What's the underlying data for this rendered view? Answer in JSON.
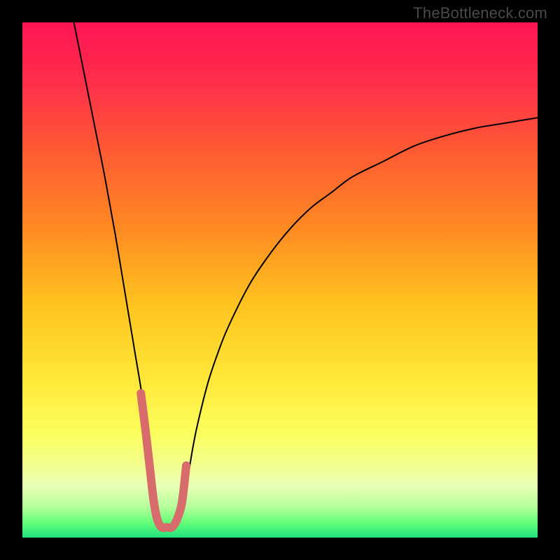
{
  "watermark": "TheBottleneck.com",
  "chart_data": {
    "type": "line",
    "title": "",
    "xlabel": "",
    "ylabel": "",
    "xlim": [
      0,
      100
    ],
    "ylim": [
      0,
      100
    ],
    "background_gradient": {
      "stops": [
        {
          "offset": 0.0,
          "color": "#ff1454"
        },
        {
          "offset": 0.12,
          "color": "#ff2f4a"
        },
        {
          "offset": 0.25,
          "color": "#ff5a33"
        },
        {
          "offset": 0.4,
          "color": "#ff8a22"
        },
        {
          "offset": 0.55,
          "color": "#ffc41f"
        },
        {
          "offset": 0.7,
          "color": "#ffe93a"
        },
        {
          "offset": 0.8,
          "color": "#fbff5e"
        },
        {
          "offset": 0.86,
          "color": "#f2ff8f"
        },
        {
          "offset": 0.9,
          "color": "#e8ffb6"
        },
        {
          "offset": 0.94,
          "color": "#b6ff9a"
        },
        {
          "offset": 0.97,
          "color": "#66ff7a"
        },
        {
          "offset": 1.0,
          "color": "#1fe27a"
        }
      ]
    },
    "series": [
      {
        "name": "curve",
        "color": "#000000",
        "stroke_width": 2,
        "x": [
          10,
          12,
          14,
          16,
          18,
          20,
          21,
          22,
          23,
          24,
          24.5,
          25,
          25.5,
          26,
          27,
          28,
          29,
          30,
          31,
          32,
          33,
          34,
          36,
          38,
          40,
          44,
          48,
          52,
          56,
          60,
          64,
          70,
          76,
          82,
          88,
          94,
          100
        ],
        "y": [
          100,
          90,
          80,
          70,
          59,
          47,
          41,
          35,
          29,
          22,
          17,
          11,
          6,
          3,
          2,
          2,
          2,
          3,
          6,
          11,
          17,
          22,
          30,
          36,
          41,
          49,
          55,
          60,
          64,
          67,
          70,
          73,
          76,
          78,
          79.5,
          80.5,
          81.5
        ]
      },
      {
        "name": "bottom-highlight",
        "color": "#d86b6b",
        "stroke_width": 12,
        "linecap": "round",
        "x": [
          23.0,
          24.0,
          24.8,
          25.5,
          26.2,
          27.0,
          28.0,
          29.0,
          30.0,
          31.0,
          31.8
        ],
        "y": [
          28.0,
          20.0,
          13.0,
          7.0,
          3.5,
          2.0,
          2.0,
          2.0,
          3.5,
          7.0,
          14.0
        ]
      }
    ]
  }
}
